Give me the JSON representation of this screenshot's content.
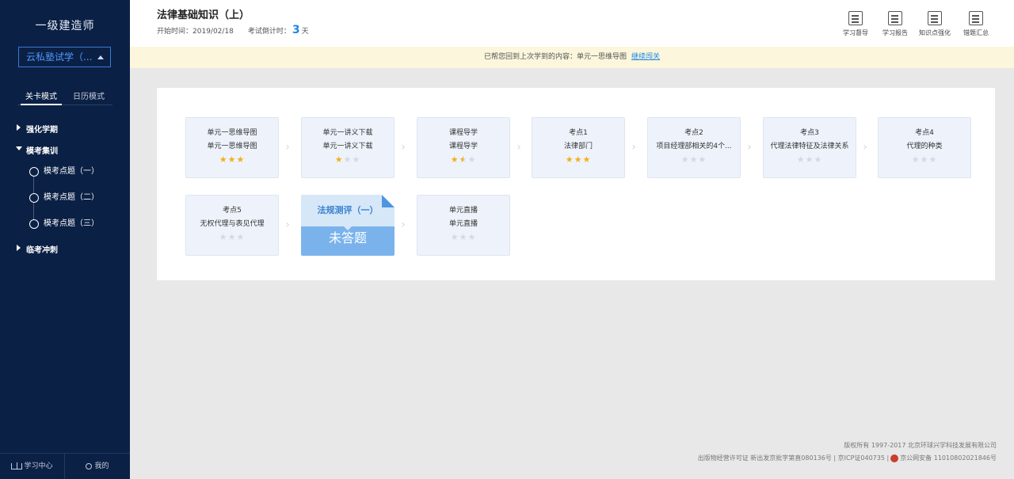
{
  "sidebar": {
    "title": "一级建造师",
    "select_value": "云私塾试学（...",
    "modes": [
      "关卡模式",
      "日历模式"
    ],
    "groups": [
      {
        "label": "强化学期"
      },
      {
        "label": "模考集训"
      },
      {
        "label": "临考冲刺"
      }
    ],
    "sub_items": [
      "模考点题（一）",
      "模考点题（二）",
      "模考点题（三）"
    ],
    "bottom": {
      "study_center": "学习中心",
      "mine": "我的"
    }
  },
  "header": {
    "course_title": "法律基础知识（上）",
    "start_label": "开始时间：",
    "start_date": "2019/02/18",
    "countdown_label": "考试倒计时：",
    "countdown_value": "3",
    "countdown_unit": "天",
    "tools": [
      "学习督导",
      "学习报告",
      "知识点强化",
      "错题汇总"
    ]
  },
  "notice": {
    "text": "已帮您回到上次学到的内容：单元一思维导图",
    "link": "继续闯关"
  },
  "nodes": [
    {
      "line1": "单元一思维导图",
      "line2": "单元一思维导图",
      "stars": [
        1,
        1,
        1
      ]
    },
    {
      "line1": "单元一讲义下载",
      "line2": "单元一讲义下载",
      "stars": [
        1,
        0,
        0
      ]
    },
    {
      "line1": "课程导学",
      "line2": "课程导学",
      "stars": [
        1,
        0.5,
        0
      ]
    },
    {
      "line1": "考点1",
      "line2": "法律部门",
      "stars": [
        1,
        1,
        1
      ]
    },
    {
      "line1": "考点2",
      "line2": "项目经理部相关的4个...",
      "stars": [
        0,
        0,
        0
      ]
    },
    {
      "line1": "考点3",
      "line2": "代理法律特征及法律关系",
      "stars": [
        0,
        0,
        0
      ]
    },
    {
      "line1": "考点4",
      "line2": "代理的种类",
      "stars": [
        0,
        0,
        0
      ]
    },
    {
      "line1": "考点5",
      "line2": "无权代理与表见代理",
      "stars": [
        0,
        0,
        0
      ]
    },
    {
      "line1": "单元直播",
      "line2": "单元直播",
      "stars": [
        0,
        0,
        0
      ]
    }
  ],
  "active_node": {
    "title": "法规测评（一）",
    "status": "未答题"
  },
  "footer": {
    "line1": "版权所有 1997-2017 北京环球兴学科技发展有限公司",
    "line2a": "出版物经营许可证 新出发京批字第直080136号 | 京ICP证040735 |",
    "line2b": "京公网安备 11010802021846号"
  }
}
